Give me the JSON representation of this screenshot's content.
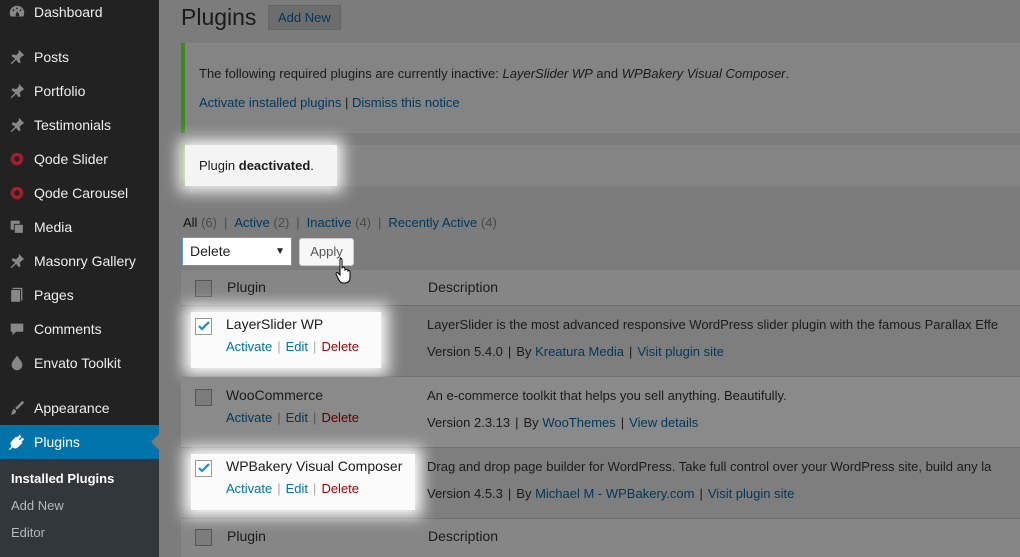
{
  "sidebar": {
    "items": [
      {
        "label": "Dashboard",
        "icon": "dashboard-icon"
      },
      {
        "label": "Posts",
        "icon": "pin-icon"
      },
      {
        "label": "Portfolio",
        "icon": "pin-icon"
      },
      {
        "label": "Testimonials",
        "icon": "pin-icon"
      },
      {
        "label": "Qode Slider",
        "icon": "slider-circle-icon"
      },
      {
        "label": "Qode Carousel",
        "icon": "slider-circle-icon"
      },
      {
        "label": "Media",
        "icon": "media-icon"
      },
      {
        "label": "Masonry Gallery",
        "icon": "pin-icon"
      },
      {
        "label": "Pages",
        "icon": "pages-icon"
      },
      {
        "label": "Comments",
        "icon": "comment-icon"
      },
      {
        "label": "Envato Toolkit",
        "icon": "drop-icon"
      },
      {
        "label": "Appearance",
        "icon": "brush-icon"
      },
      {
        "label": "Plugins",
        "icon": "plugin-icon"
      }
    ],
    "submenu": [
      {
        "label": "Installed Plugins"
      },
      {
        "label": "Add New"
      },
      {
        "label": "Editor"
      }
    ]
  },
  "header": {
    "title": "Plugins",
    "add_new": "Add New"
  },
  "notice_required": {
    "text_prefix": "The following required plugins are currently inactive: ",
    "plugin_1": "LayerSlider WP",
    "and": " and ",
    "plugin_2": "WPBakery Visual Composer",
    "period": ".",
    "link_activate": "Activate installed plugins",
    "sep": " | ",
    "link_dismiss": "Dismiss this notice"
  },
  "notice_deactivated": {
    "prefix": "Plugin ",
    "bold": "deactivated",
    "suffix": "."
  },
  "filters": {
    "all": "All",
    "all_count": "(6)",
    "active": "Active",
    "active_count": "(2)",
    "inactive": "Inactive",
    "inactive_count": "(4)",
    "recent": "Recently Active",
    "recent_count": "(4)",
    "sep": "|"
  },
  "bulk": {
    "selected": "Delete",
    "apply": "Apply"
  },
  "table": {
    "col_plugin": "Plugin",
    "col_description": "Description",
    "rows": [
      {
        "name": "LayerSlider WP",
        "checked": true,
        "actions": {
          "activate": "Activate",
          "edit": "Edit",
          "delete": "Delete"
        },
        "description": "LayerSlider is the most advanced responsive WordPress slider plugin with the famous Parallax Effe",
        "version": "Version 5.4.0",
        "by": "By",
        "author": "Kreatura Media",
        "link": "Visit plugin site"
      },
      {
        "name": "WooCommerce",
        "checked": false,
        "actions": {
          "activate": "Activate",
          "edit": "Edit",
          "delete": "Delete"
        },
        "description": "An e-commerce toolkit that helps you sell anything. Beautifully.",
        "version": "Version 2.3.13",
        "by": "By",
        "author": "WooThemes",
        "link": "View details"
      },
      {
        "name": "WPBakery Visual Composer",
        "checked": true,
        "actions": {
          "activate": "Activate",
          "edit": "Edit",
          "delete": "Delete"
        },
        "description": "Drag and drop page builder for WordPress. Take full control over your WordPress site, build any la",
        "version": "Version 4.5.3",
        "by": "By",
        "author": "Michael M - WPBakery.com",
        "link": "Visit plugin site"
      }
    ]
  },
  "colors": {
    "sidebar_bg": "#222222",
    "active_menu": "#0073aa",
    "notice_border": "#3d8a1c",
    "delete_link": "#aa0000"
  }
}
